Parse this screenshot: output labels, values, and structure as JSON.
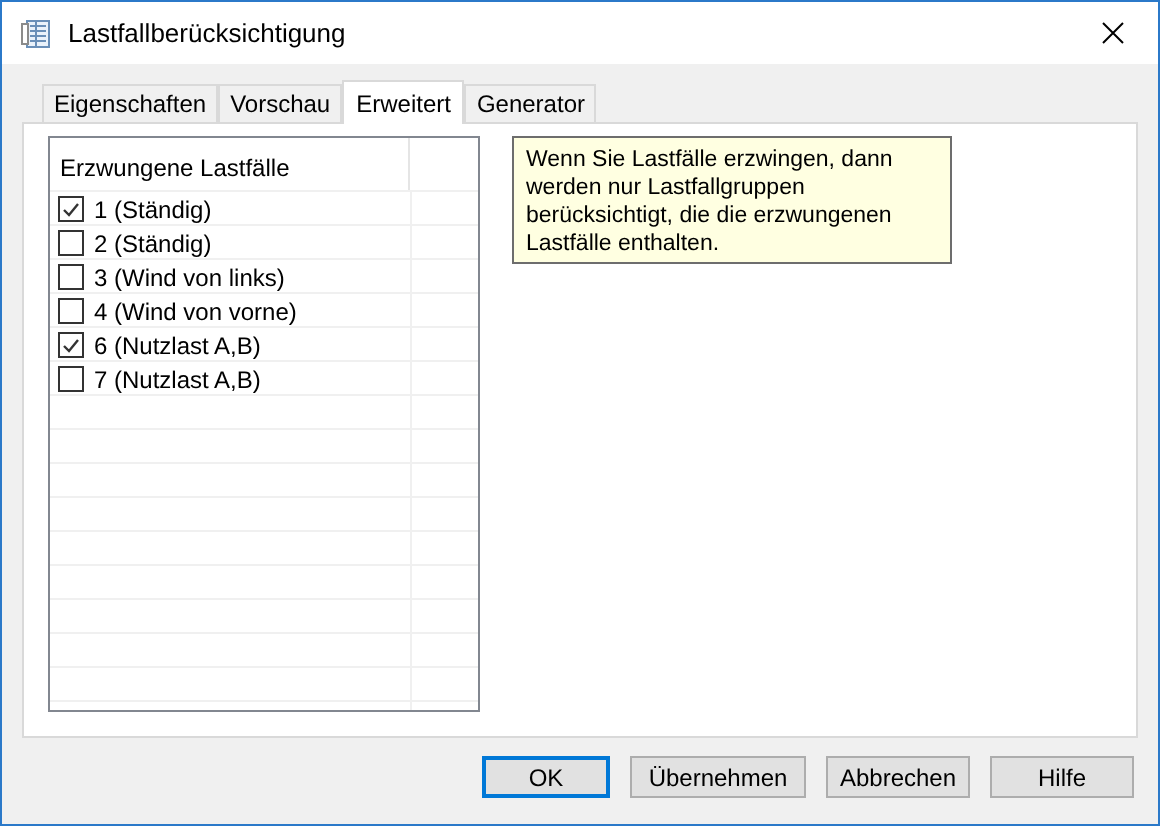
{
  "window": {
    "title": "Lastfallberücksichtigung"
  },
  "tabs": [
    {
      "label": "Eigenschaften",
      "selected": false
    },
    {
      "label": "Vorschau",
      "selected": false
    },
    {
      "label": "Erweitert",
      "selected": true
    },
    {
      "label": "Generator",
      "selected": false
    }
  ],
  "list": {
    "header": "Erzwungene Lastfälle",
    "items": [
      {
        "label": "1 (Ständig)",
        "checked": true
      },
      {
        "label": "2 (Ständig)",
        "checked": false
      },
      {
        "label": "3 (Wind von links)",
        "checked": false
      },
      {
        "label": "4 (Wind von vorne)",
        "checked": false
      },
      {
        "label": "6 (Nutzlast A,B)",
        "checked": true
      },
      {
        "label": "7 (Nutzlast A,B)",
        "checked": false
      }
    ]
  },
  "note": "Wenn Sie Lastfälle erzwingen, dann werden nur Lastfallgruppen berücksichtigt, die die erzwungenen Lastfälle enthalten.",
  "buttons": [
    {
      "label": "OK",
      "default": true
    },
    {
      "label": "Übernehmen",
      "default": false
    },
    {
      "label": "Abbrechen",
      "default": false
    },
    {
      "label": "Hilfe",
      "default": false
    }
  ]
}
